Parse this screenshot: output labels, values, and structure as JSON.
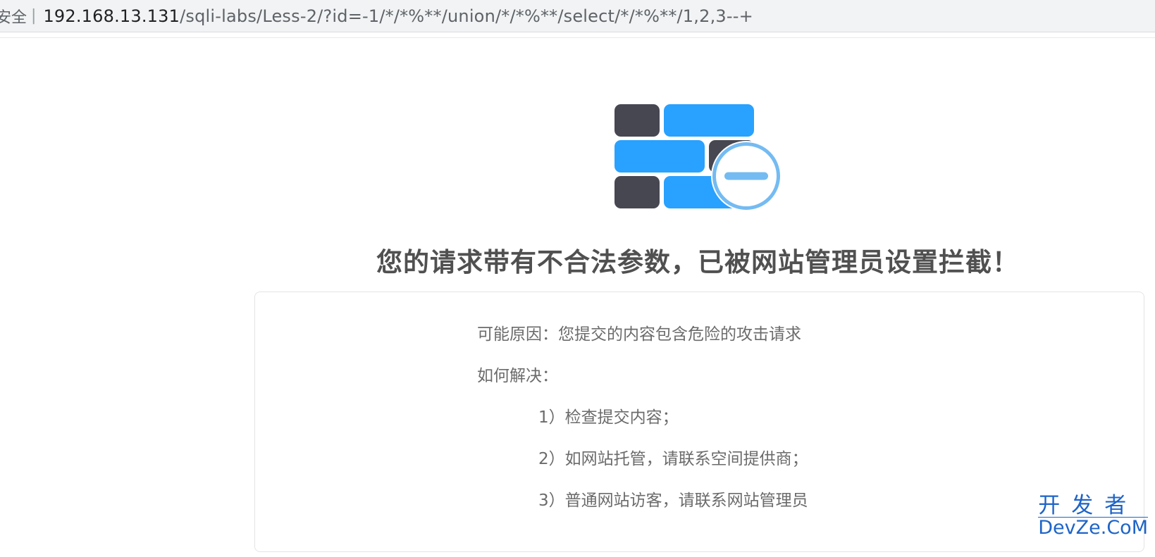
{
  "address_bar": {
    "security_label": "安全",
    "url_host": "192.168.13.131",
    "url_path": "/sqli-labs/Less-2/?id=-1/*/*%**/union/*/*%**/select/*/*%**/1,2,3--+"
  },
  "waf_page": {
    "title": "您的请求带有不合法参数，已被网站管理员设置拦截！",
    "reason": "可能原因：您提交的内容包含危险的攻击请求",
    "how_to_solve": "如何解决：",
    "steps": [
      "1）检查提交内容；",
      "2）如网站托管，请联系空间提供商；",
      "3）普通网站访客，请联系网站管理员"
    ]
  },
  "watermark": {
    "cn": "开发者",
    "en": "DevZe.CoM"
  },
  "colors": {
    "brick_dark": "#474752",
    "brick_blue": "#29a1ff",
    "badge_light_blue": "#74bbf2",
    "title_gray": "#505050",
    "watermark_blue": "#1e64c8"
  },
  "icons": [
    "firewall-brick-icon",
    "blocked-minus-icon"
  ]
}
